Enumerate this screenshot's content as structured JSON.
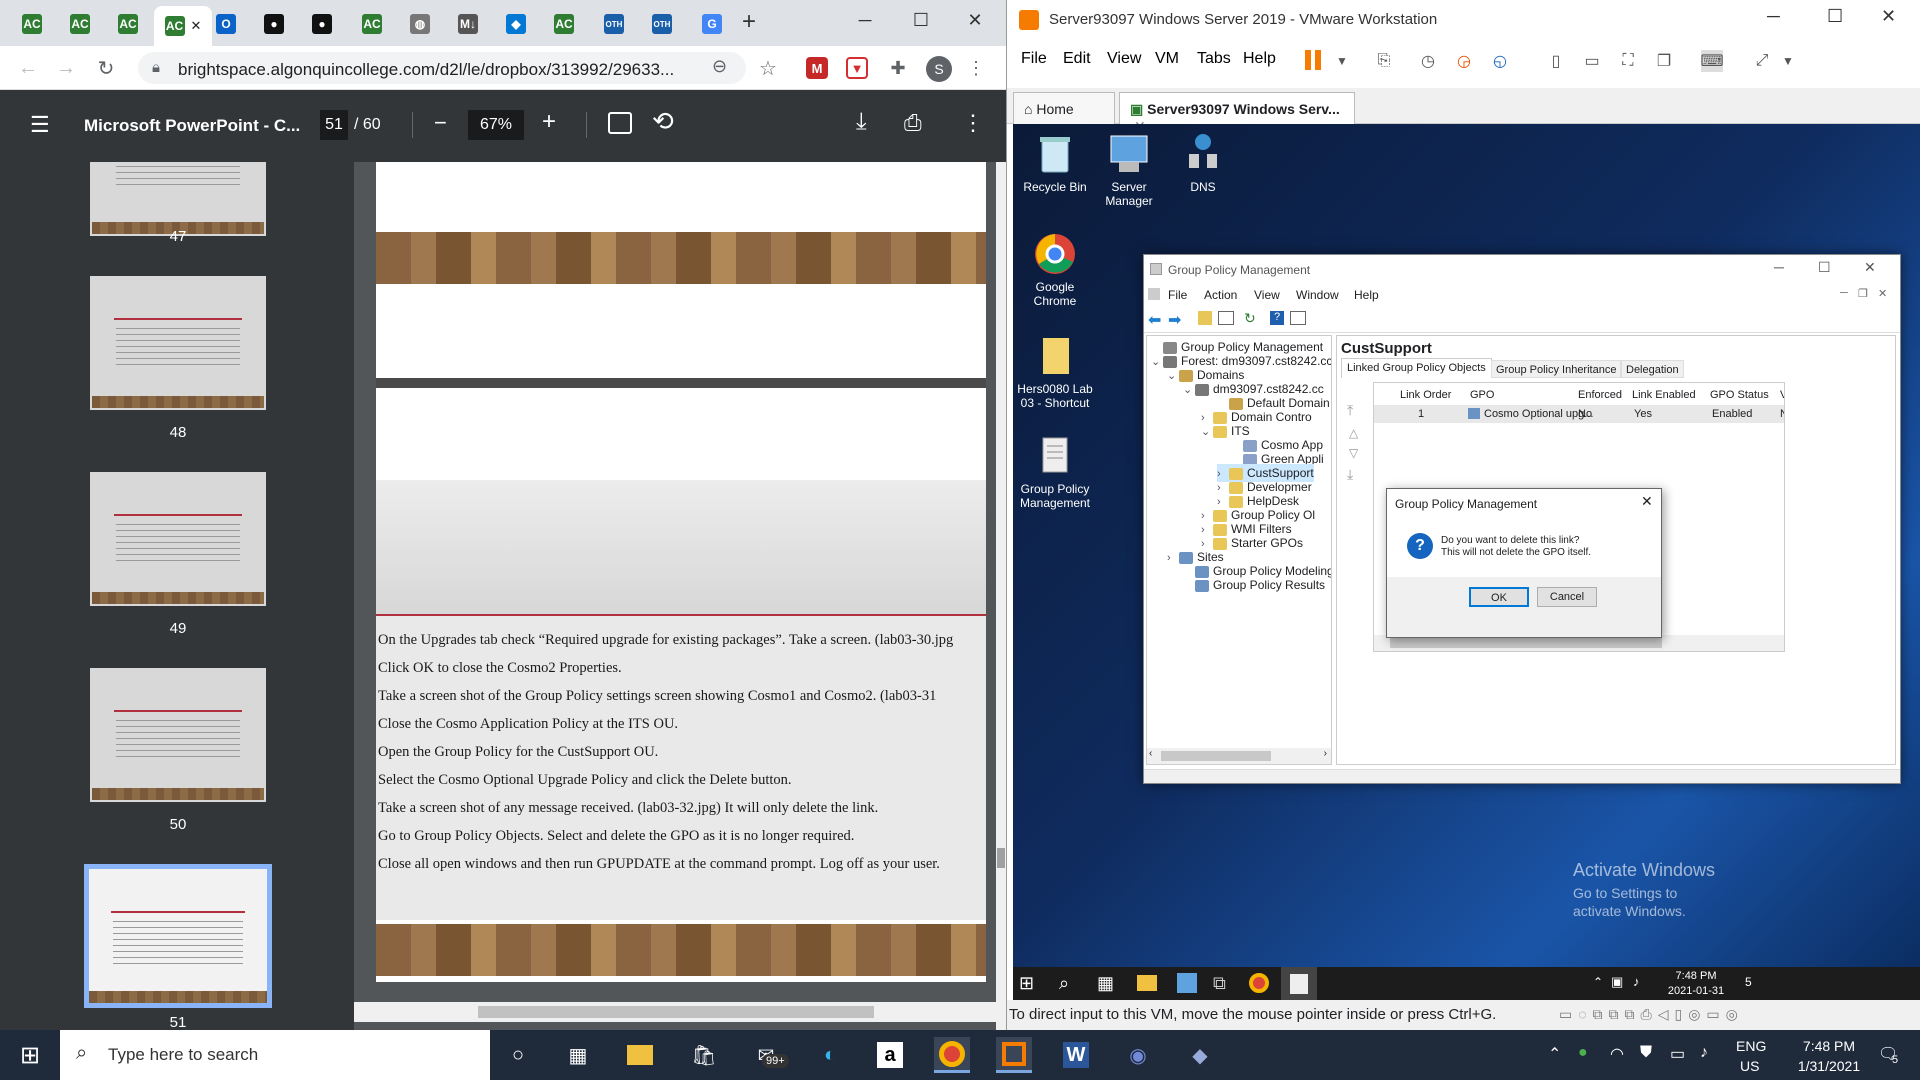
{
  "chrome": {
    "tabs": [
      {
        "icon": "ac-icon",
        "label": "AC",
        "color": "#2e7d32"
      },
      {
        "icon": "ac-icon",
        "label": "AC",
        "color": "#2e7d32"
      },
      {
        "icon": "ac-icon",
        "label": "AC",
        "color": "#2e7d32"
      },
      {
        "icon": "ac-icon",
        "label": "AC",
        "color": "#2e7d32"
      },
      {
        "icon": "outlook-icon",
        "label": "O",
        "color": "#0a64c8"
      },
      {
        "icon": "github-icon",
        "label": "●",
        "color": "#111111"
      },
      {
        "icon": "github-icon",
        "label": "●",
        "color": "#111111"
      },
      {
        "icon": "ac-icon",
        "label": "AC",
        "color": "#2e7d32"
      },
      {
        "icon": "globe-icon",
        "label": "◍",
        "color": "#777777"
      },
      {
        "icon": "markdown-icon",
        "label": "M↓",
        "color": "#555555"
      },
      {
        "icon": "vscode-icon",
        "label": "◆",
        "color": "#0078d4"
      },
      {
        "icon": "ac-icon",
        "label": "AC",
        "color": "#2e7d32"
      },
      {
        "icon": "oth-icon",
        "label": "OTH",
        "color": "#1a5fa8"
      },
      {
        "icon": "oth-icon",
        "label": "OTH",
        "color": "#1a5fa8"
      },
      {
        "icon": "google-icon",
        "label": "G",
        "color": "#4285f4"
      }
    ],
    "new_tab": "+",
    "url": "brightspace.algonquincollege.com/d2l/le/dropbox/313992/29633...",
    "profile_initial": "S"
  },
  "pdf": {
    "title": "Microsoft PowerPoint - C...",
    "page_current": "51",
    "page_total": "/ 60",
    "zoom": "67%",
    "thumbnails": [
      {
        "num": "47"
      },
      {
        "num": "48"
      },
      {
        "num": "49"
      },
      {
        "num": "50"
      },
      {
        "num": "51"
      }
    ],
    "slide_lines": [
      "On the Upgrades tab check “Required upgrade for existing packages”. Take a screen. (lab03-30.jpg",
      "Click OK to close the Cosmo2 Properties.",
      "Take a screen shot of the Group Policy settings screen showing Cosmo1 and Cosmo2. (lab03-31",
      "Close the Cosmo Application Policy at the ITS OU.",
      "Open the Group Policy for the CustSupport OU.",
      "Select the Cosmo Optional Upgrade Policy and click the Delete button.",
      "Take a screen shot of any message received. (lab03-32.jpg) It will only delete the link.",
      "Go to Group Policy Objects. Select and delete the GPO as it is no longer required.",
      "Close all open windows and then run GPUPDATE at the command prompt. Log off as your user."
    ]
  },
  "vmware": {
    "title": "Server93097 Windows Server 2019 - VMware Workstation",
    "menu": [
      "File",
      "Edit",
      "View",
      "VM",
      "Tabs",
      "Help"
    ],
    "tab_home": "Home",
    "tab_vm": "Server93097 Windows Serv...",
    "status": "To direct input to this VM, move the mouse pointer inside or press Ctrl+G.",
    "desktop_icons": [
      {
        "name": "Recycle Bin"
      },
      {
        "name": "Server Manager"
      },
      {
        "name": "DNS"
      },
      {
        "name": "Google Chrome"
      },
      {
        "name": "Hers0080 Lab 03 - Shortcut"
      },
      {
        "name": "Group Policy Management"
      }
    ],
    "activate_title": "Activate Windows",
    "activate_sub": "Go to Settings to activate Windows.",
    "vm_clock_time": "7:48 PM",
    "vm_clock_date": "2021-01-31",
    "vm_notif_count": "5"
  },
  "gpm": {
    "title": "Group Policy Management",
    "menu": [
      "File",
      "Action",
      "View",
      "Window",
      "Help"
    ],
    "tree": [
      "Group Policy Management",
      "Forest: dm93097.cst8242.cc",
      "Domains",
      "dm93097.cst8242.cc",
      "Default Domain",
      "Domain Contro",
      "ITS",
      "Cosmo App",
      "Green Appli",
      "CustSupport",
      "Developmer",
      "HelpDesk",
      "Group Policy Ol",
      "WMI Filters",
      "Starter GPOs",
      "Sites",
      "Group Policy Modeling",
      "Group Policy Results"
    ],
    "heading": "CustSupport",
    "tabs": [
      "Linked Group Policy Objects",
      "Group Policy Inheritance",
      "Delegation"
    ],
    "columns": [
      "Link Order",
      "GPO",
      "Enforced",
      "Link Enabled",
      "GPO Status",
      "V"
    ],
    "rows": [
      [
        "1",
        "Cosmo Optional upg...",
        "No",
        "Yes",
        "Enabled",
        "N"
      ]
    ]
  },
  "dialog": {
    "title": "Group Policy Management",
    "line1": "Do you want to delete this link?",
    "line2": "This will not delete the GPO itself.",
    "ok": "OK",
    "cancel": "Cancel",
    "close": "✕"
  },
  "taskbar": {
    "search_placeholder": "Type here to search",
    "mail_badge": "99+",
    "lang1": "ENG",
    "lang2": "US",
    "time": "7:48 PM",
    "date": "1/31/2021",
    "notif_count": "5"
  }
}
